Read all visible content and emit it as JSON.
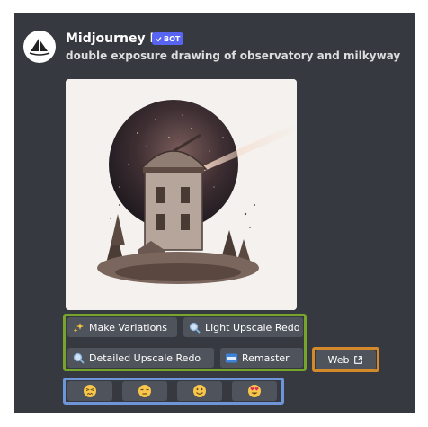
{
  "message": {
    "author": "Midjourney Bot",
    "badge": "BOT",
    "prompt": "double exposure drawing of observatory and milkyway",
    "image_subject": "observatory-milkyway-double-exposure"
  },
  "buttons": {
    "make_variations": "Make Variations",
    "light_upscale_redo": "Light Upscale Redo",
    "detailed_upscale_redo": "Detailed Upscale Redo",
    "remaster": "Remaster",
    "web": "Web"
  },
  "reactions": [
    {
      "icon": "confounded-face-icon"
    },
    {
      "icon": "unamused-face-icon"
    },
    {
      "icon": "smiling-face-icon"
    },
    {
      "icon": "heart-eyes-face-icon"
    }
  ],
  "colors": {
    "panel": "#36393f",
    "button": "#4f545c",
    "bot_badge": "#5865f2",
    "highlight_green": "#77a52c",
    "highlight_orange": "#d48a2b",
    "highlight_blue": "#6d95d8"
  }
}
